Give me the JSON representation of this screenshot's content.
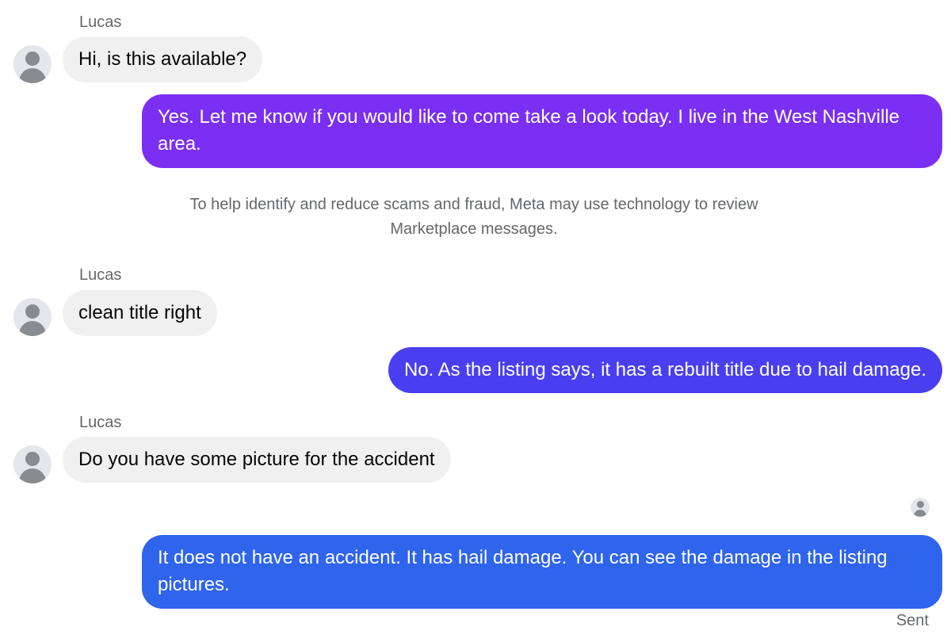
{
  "thread": {
    "messages": [
      {
        "direction": "incoming",
        "sender": "Lucas",
        "text": "Hi, is this available?"
      },
      {
        "direction": "outgoing",
        "text": "Yes. Let me know if you would like to come take a look today. I live in the West Nashville area.",
        "color": "#7b2ff2"
      },
      {
        "direction": "incoming",
        "sender": "Lucas",
        "text": "clean title right"
      },
      {
        "direction": "outgoing",
        "text": "No. As the listing says, it has a rebuilt title due to hail damage.",
        "color": "#4a3ff0"
      },
      {
        "direction": "incoming",
        "sender": "Lucas",
        "text": "Do you have some picture for the accident"
      },
      {
        "direction": "outgoing",
        "text": "It does not have an accident. It has hail damage. You can see the damage in the listing pictures.",
        "color": "#2f64ec"
      }
    ],
    "notice": "To help identify and reduce scams and fraud, Meta may use technology to review Marketplace messages.",
    "status": "Sent",
    "icons": {
      "avatar": "person-silhouette-icon",
      "seen": "seen-avatar-icon"
    }
  }
}
